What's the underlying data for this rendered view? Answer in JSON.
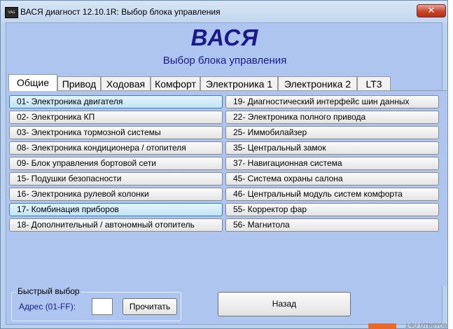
{
  "window": {
    "title": "ВАСЯ диагност 12.10.1R:  Выбор блока управления",
    "close_label": "✕",
    "icon_label": "VAG COM"
  },
  "header": {
    "app_name": "ВАСЯ",
    "subtitle": "Выбор блока управления"
  },
  "tabs": [
    {
      "label": "Общие"
    },
    {
      "label": "Привод"
    },
    {
      "label": "Ходовая"
    },
    {
      "label": "Комфорт"
    },
    {
      "label": "Электроника 1"
    },
    {
      "label": "Электроника 2"
    },
    {
      "label": "LT3"
    }
  ],
  "modules_left": [
    {
      "label": "01- Электроника двигателя"
    },
    {
      "label": "02- Электроника КП"
    },
    {
      "label": "03- Электроника тормозной системы"
    },
    {
      "label": "08- Электроника кондиционера / отопителя"
    },
    {
      "label": "09- Блок управления бортовой сети"
    },
    {
      "label": "15- Подушки безопасности"
    },
    {
      "label": "16- Электроника рулевой колонки"
    },
    {
      "label": "17- Комбинация приборов"
    },
    {
      "label": "18- Дополнительный / автономный отопитель"
    }
  ],
  "modules_right": [
    {
      "label": "19- Диагностический интерфейс шин данных"
    },
    {
      "label": "22- Электроника полного привода"
    },
    {
      "label": "25- Иммобилайзер"
    },
    {
      "label": "35- Центральный замок"
    },
    {
      "label": "37- Навигационная система"
    },
    {
      "label": "45- Система охраны салона"
    },
    {
      "label": "46- Центральный модуль систем комфорта"
    },
    {
      "label": "55- Корректор фар"
    },
    {
      "label": "56- Магнитола"
    }
  ],
  "quick_select": {
    "legend": "Быстрый выбор",
    "address_label": "Адрес (01-FF):",
    "address_value": "",
    "read_button": "Прочитать"
  },
  "back_button": "Назад",
  "bottom_strip": {
    "answers_text": "140 ответов"
  }
}
